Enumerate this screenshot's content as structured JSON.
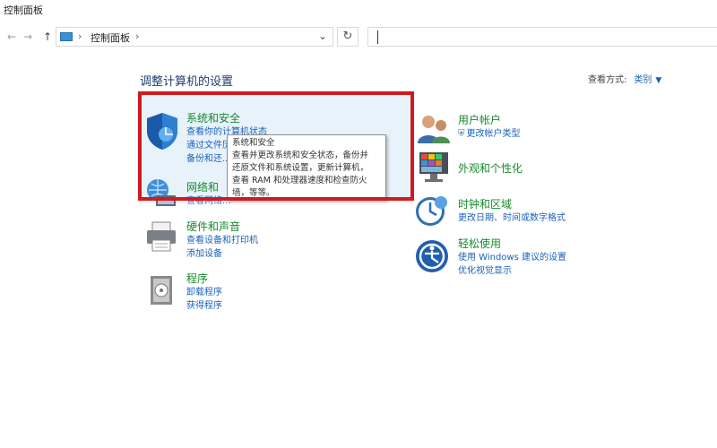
{
  "window": {
    "title": "控制面板"
  },
  "address": {
    "location": "控制面板",
    "separator": "›"
  },
  "nav": {
    "back": "←",
    "forward": "→",
    "up": "↑",
    "recent": "⌄",
    "refresh": "↻"
  },
  "page": {
    "heading": "调整计算机的设置",
    "view_by_label": "查看方式:",
    "view_by_value": "类别"
  },
  "left_categories": [
    {
      "title": "系统和安全",
      "icon": "shield-icon",
      "links": [
        "查看你的计算机状态",
        "通过文件历...",
        "备份和还..."
      ]
    },
    {
      "title": "网络和",
      "icon": "network-icon",
      "links": [
        "查看网络..."
      ]
    },
    {
      "title": "硬件和声音",
      "icon": "printer-icon",
      "links": [
        "查看设备和打印机",
        "添加设备"
      ]
    },
    {
      "title": "程序",
      "icon": "programs-icon",
      "links": [
        "卸载程序",
        "获得程序"
      ]
    }
  ],
  "right_categories": [
    {
      "title": "用户帐户",
      "icon": "users-icon",
      "links": [
        "更改帐户类型"
      ]
    },
    {
      "title": "外观和个性化",
      "icon": "appearance-icon",
      "links": []
    },
    {
      "title": "时钟和区域",
      "icon": "clock-icon",
      "links": [
        "更改日期、时间或数字格式"
      ]
    },
    {
      "title": "轻松使用",
      "icon": "ease-of-access-icon",
      "links": [
        "使用 Windows 建议的设置",
        "优化视觉显示"
      ]
    }
  ],
  "tooltip": {
    "lines": [
      "系统和安全",
      "查看并更改系统和安全状态，备份并",
      "还原文件和系统设置，更新计算机，",
      "查看 RAM 和处理器速度和检查防火",
      "墙，等等。"
    ]
  },
  "colors": {
    "highlight_border": "#d01a1f",
    "category_title": "#178a2c",
    "link": "#1a62b8"
  }
}
